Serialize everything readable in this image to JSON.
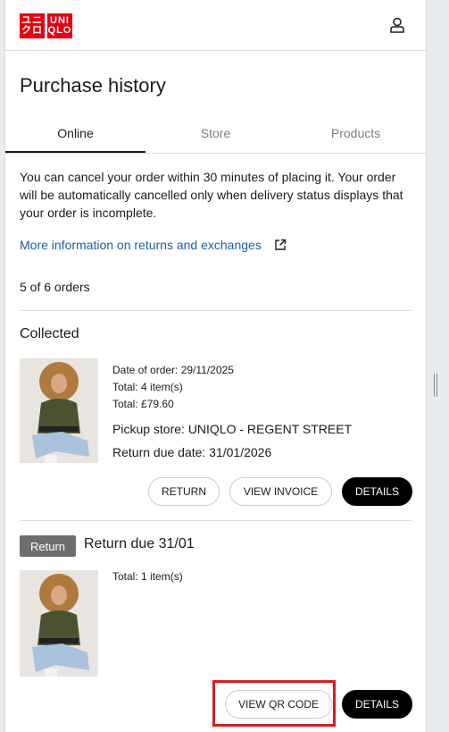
{
  "header": {
    "logo_top": "ユニ",
    "logo_bottom": "クロ",
    "logo_top_right": "UNI",
    "logo_bottom_right": "QLO",
    "brand_color": "#e60012"
  },
  "page_title": "Purchase history",
  "tabs": [
    {
      "label": "Online",
      "active": true
    },
    {
      "label": "Store",
      "active": false
    },
    {
      "label": "Products",
      "active": false
    }
  ],
  "info_text": "You can cancel your order within 30 minutes of placing it. Your order will be automatically cancelled only when delivery status displays that your order is incomplete.",
  "more_info_link": "More information on returns and exchanges",
  "order_count": "5 of 6 orders",
  "orders": [
    {
      "status": "Collected",
      "date_of_order": "Date of order: 29/11/2025",
      "total_items": "Total: 4 item(s)",
      "total_price": "Total: £79.60",
      "pickup_store": "Pickup store: UNIQLO - REGENT STREET",
      "return_due_date": "Return due date: 31/01/2026",
      "buttons": {
        "return": "RETURN",
        "view_invoice": "VIEW INVOICE",
        "details": "DETAILS"
      }
    },
    {
      "badge": "Return",
      "status": "Return due 31/01",
      "total_items": "Total: 1 item(s)",
      "buttons": {
        "view_qr_code": "VIEW QR CODE",
        "details": "DETAILS"
      }
    }
  ],
  "colors": {
    "link": "#1a5fa5",
    "highlight": "#d81b24",
    "badge": "#6e6e6e"
  }
}
